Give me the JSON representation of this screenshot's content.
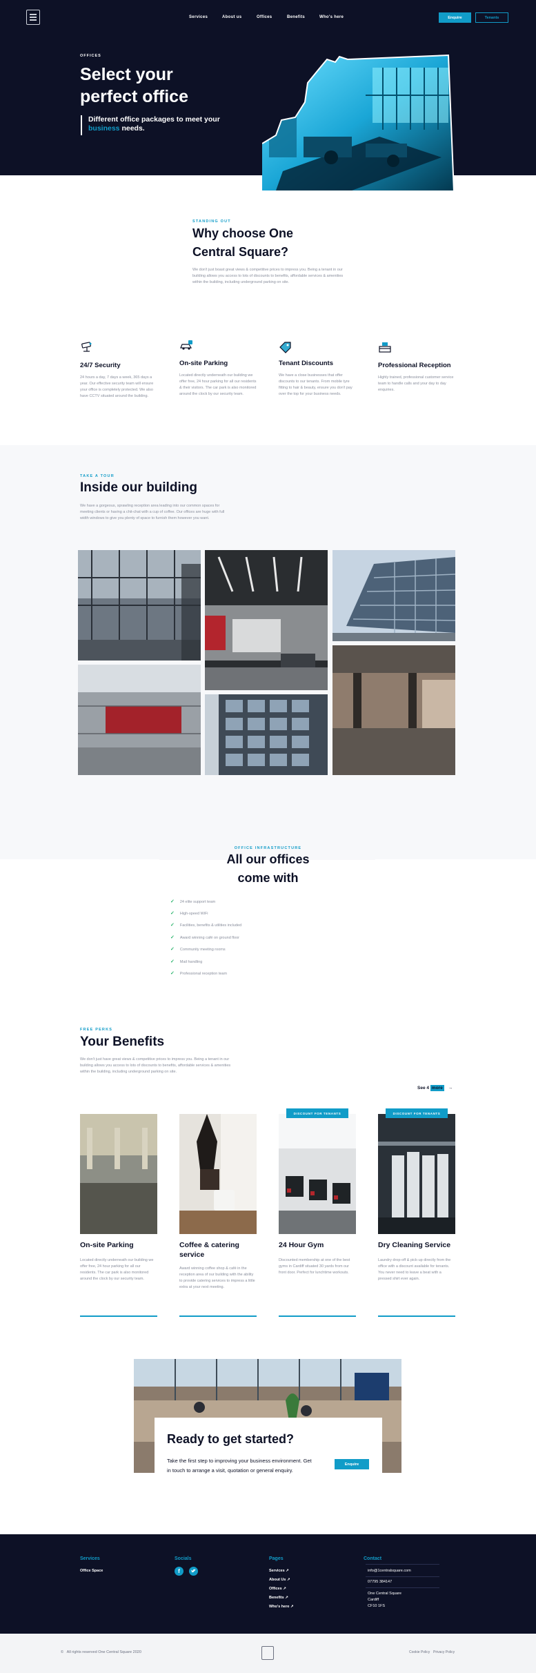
{
  "nav": {
    "links": [
      "Services",
      "About us",
      "Offices",
      "Benefits",
      "Who's here"
    ],
    "enquire": "Enquire",
    "tenants": "Tenants"
  },
  "hero": {
    "eyebrow": "OFFICES",
    "title": "Select your perfect office",
    "sub_prefix": "Different office packages to meet your ",
    "sub_accent": "business",
    "sub_suffix": " needs."
  },
  "why": {
    "eyebrow": "STANDING OUT",
    "title": "Why choose One Central Square?",
    "body": "We don't just boast great views & competitive prices to impress you. Being a tenant in our building allows you access to lots of discounts to benefits, affordable services & amenities within the building, including underground parking on site.",
    "features": [
      {
        "icon": "cctv-camera-icon",
        "title": "24/7 Security",
        "desc": "24 hours a day, 7 days a week, 365 days a year. Our effective security team will ensure your office is completely protected. We also have CCTV situated around the building."
      },
      {
        "icon": "parking-car-icon",
        "title": "On-site Parking",
        "desc": "Located directly underneath our building we offer free, 24 hour parking for all our residents & their visitors. The car park is also monitored around the clock by our security team."
      },
      {
        "icon": "discount-tag-icon",
        "title": "Tenant Discounts",
        "desc": "We have a close businesses that offer discounts to our tenants. From mobile tyre fitting to hair & beauty, ensure you don't pay over the top for your business needs."
      },
      {
        "icon": "reception-desk-icon",
        "title": "Professional Reception",
        "desc": "Highly trained, professional customer service team to handle calls and your day to day enquiries."
      }
    ]
  },
  "tour": {
    "eyebrow": "TAKE A TOUR",
    "title": "Inside our building",
    "body": "We have a gorgeous, sprawling reception area leading into our common spaces for meeting clients or having a chit-chat with a cup of coffee. Our offices are huge with full width windows to give you plenty of space to furnish them however you want."
  },
  "offices": {
    "eyebrow": "OFFICE INFRASTRUCTURE",
    "title": "All our offices come with",
    "items": [
      "24 elite support team",
      "High-speed WiFi",
      "Facilities, benefits & utilities included",
      "Award winning café on ground floor",
      "Community meeting rooms",
      "Mail handling",
      "Professional reception team"
    ]
  },
  "benefits": {
    "eyebrow": "FREE PERKS",
    "title": "Your Benefits",
    "body": "We don't just have great views & competitive prices to impress you. Being a tenant in our building allows you access to lots of discounts to benefits, affordable services & amenities within the building, including underground parking on site.",
    "pager_prefix": "See 4 ",
    "pager_accent": "more",
    "items": [
      {
        "title": "On-site Parking",
        "desc": "Located directly underneath our building we offer free, 24 hour parking for all our residents. The car park is also monitored around the clock by our security team.",
        "badge": ""
      },
      {
        "title": "Coffee & catering service",
        "desc": "Award winning coffee shop & café in the reception area of our building with the ability to provide catering services to impress a little extra at your next meeting.",
        "badge": ""
      },
      {
        "title": "24 Hour Gym",
        "desc": "Discounted membership at one of the best gyms in Cardiff situated 30 yards from our front door. Perfect for lunchtime workouts.",
        "badge": "DISCOUNT FOR TENANTS"
      },
      {
        "title": "Dry Cleaning Service",
        "desc": "Laundry drop-off & pick-up directly from the office with a discount available for tenants. You never need to leave a beat with a pressed shirt ever again.",
        "badge": "DISCOUNT FOR TENANTS"
      }
    ]
  },
  "cta": {
    "title": "Ready to get started?",
    "body": "Take the first step to improving your business environment. Get in touch to arrange a visit, quotation or general enquiry.",
    "button": "Enquire"
  },
  "footer": {
    "services_h": "Services",
    "services": [
      "Office Space"
    ],
    "socials_h": "Socials",
    "pages_h": "Pages",
    "pages": [
      "Services",
      "About Us",
      "Offices",
      "Benefits",
      "Who's here"
    ],
    "contact_h": "Contact",
    "email": "info@1centralsquare.com",
    "phone": "07795 384147",
    "address": [
      "One Central Square",
      "Cardiff",
      "CF10 1FS"
    ],
    "copyright": "All rights reserved One Central Square 2020",
    "legal": [
      "Cookie Policy",
      "Privacy Policy"
    ]
  },
  "colors": {
    "accent": "#119cc8",
    "navy": "#0d1126",
    "check": "#27b36a"
  }
}
